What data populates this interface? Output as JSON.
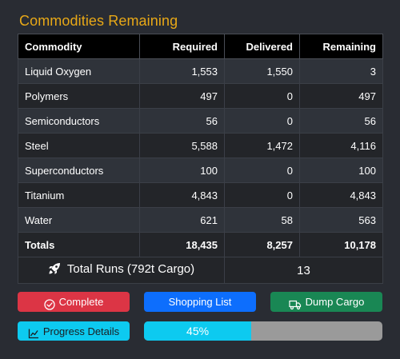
{
  "title": "Commodities Remaining",
  "table": {
    "headers": [
      "Commodity",
      "Required",
      "Delivered",
      "Remaining"
    ],
    "rows": [
      {
        "name": "Liquid Oxygen",
        "required": "1,553",
        "delivered": "1,550",
        "remaining": "3"
      },
      {
        "name": "Polymers",
        "required": "497",
        "delivered": "0",
        "remaining": "497"
      },
      {
        "name": "Semiconductors",
        "required": "56",
        "delivered": "0",
        "remaining": "56"
      },
      {
        "name": "Steel",
        "required": "5,588",
        "delivered": "1,472",
        "remaining": "4,116"
      },
      {
        "name": "Superconductors",
        "required": "100",
        "delivered": "0",
        "remaining": "100"
      },
      {
        "name": "Titanium",
        "required": "4,843",
        "delivered": "0",
        "remaining": "4,843"
      },
      {
        "name": "Water",
        "required": "621",
        "delivered": "58",
        "remaining": "563"
      }
    ],
    "totals": {
      "label": "Totals",
      "required": "18,435",
      "delivered": "8,257",
      "remaining": "10,178"
    },
    "runs": {
      "label": "Total Runs (792t Cargo)",
      "value": "13",
      "icon": "rocket-icon"
    }
  },
  "buttons": {
    "complete": {
      "label": "Complete",
      "icon": "check-circle-icon"
    },
    "shopping": {
      "label": "Shopping List"
    },
    "dump": {
      "label": "Dump Cargo",
      "icon": "truck-icon"
    },
    "progress": {
      "label": "Progress Details",
      "icon": "chart-line-icon"
    }
  },
  "progress": {
    "label": "45%",
    "value": 0.45
  },
  "colors": {
    "title": "#e8a817",
    "complete": "#dc3545",
    "shopping": "#0d6efd",
    "dump": "#198754",
    "info": "#0dcaf0",
    "progress_track": "#9a9a9a"
  }
}
